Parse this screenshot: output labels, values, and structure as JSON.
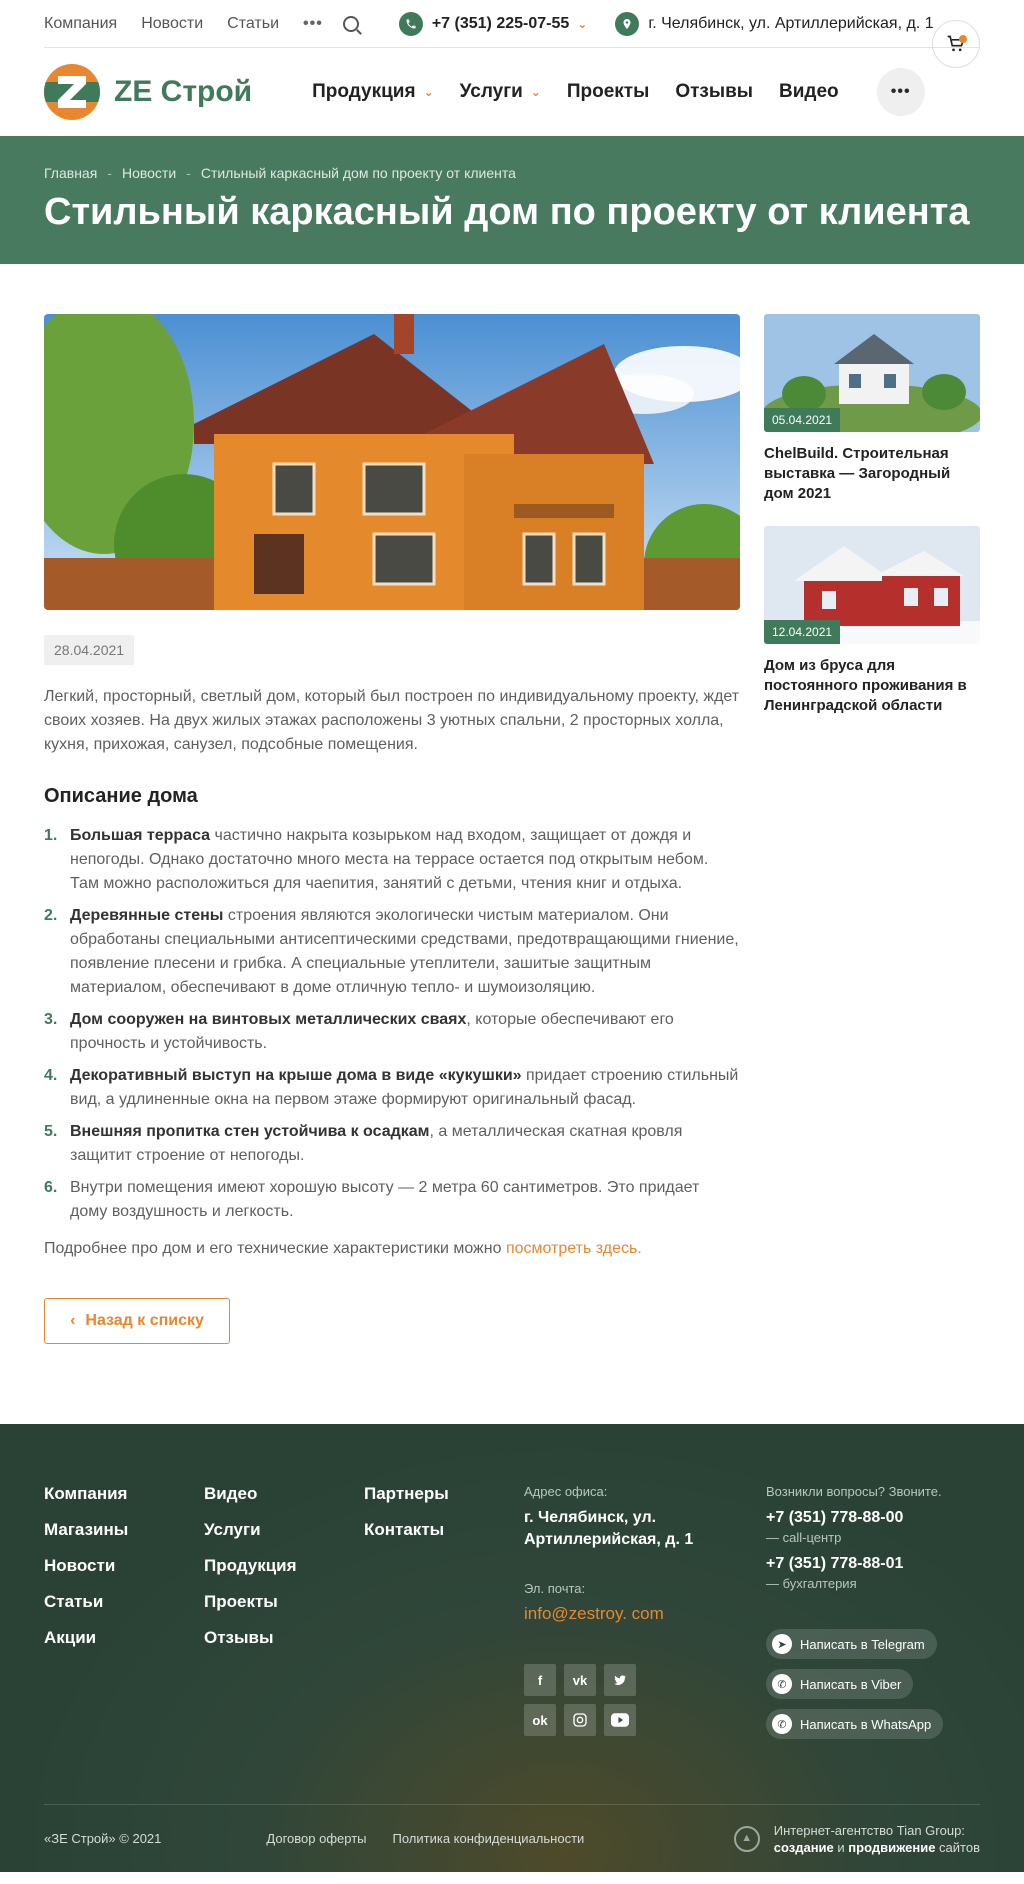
{
  "topbar": {
    "links": [
      "Компания",
      "Новости",
      "Статьи"
    ],
    "more": "•••",
    "phone": "+7 (351) 225-07-55",
    "address": "г. Челябинск, ул. Артиллерийская, д. 1"
  },
  "header": {
    "brand": "ZE Строй",
    "nav": [
      "Продукция",
      "Услуги",
      "Проекты",
      "Отзывы",
      "Видео"
    ],
    "more": "•••"
  },
  "breadcrumbs": [
    "Главная",
    "Новости",
    "Стильный каркасный дом по проекту от клиента"
  ],
  "title": "Стильный каркасный дом по проекту от клиента",
  "article": {
    "date": "28.04.2021",
    "intro": "Легкий, просторный, светлый дом, который был построен по индивидуальному проекту, ждет своих хозяев. На двух жилых этажах расположены 3 уютных спальни, 2 просторных холла, кухня, прихожая, санузел, подсобные помещения.",
    "heading": "Описание дома",
    "items": [
      {
        "num": "1.",
        "bold": "Большая терраса",
        "text": " частично накрыта козырьком над входом, защищает от дождя и непогоды. Однако достаточно много места на террасе остается под открытым небом. Там можно расположиться для чаепития, занятий с детьми, чтения книг и отдыха."
      },
      {
        "num": "2.",
        "bold": "Деревянные стены",
        "text": " строения являются экологически чистым материалом. Они обработаны специальными антисептическими средствами, предотвращающими гниение, появление плесени и грибка. А специальные утеплители, зашитые защитным материалом, обеспечивают в доме отличную тепло- и шумоизоляцию."
      },
      {
        "num": "3.",
        "bold": "Дом сооружен на винтовых металлических сваях",
        "text": ", которые обеспечивают его прочность и устойчивость."
      },
      {
        "num": "4.",
        "bold": "Декоративный выступ на крыше дома в виде «кукушки»",
        "text": " придает строению стильный вид, а удлиненные окна на первом этаже формируют оригинальный фасад."
      },
      {
        "num": "5.",
        "bold": "Внешняя пропитка стен устойчива к осадкам",
        "text": ", а металлическая скатная кровля защитит строение от непогоды."
      },
      {
        "num": "6.",
        "bold": "",
        "text": "Внутри помещения имеют хорошую высоту — 2 метра 60 сантиметров. Это придает дому воздушность и легкость."
      }
    ],
    "more_text": "Подробнее про дом и его технические характеристики можно ",
    "more_link": "посмотреть здесь.",
    "back": "Назад к списку"
  },
  "sidebar": [
    {
      "date": "05.04.2021",
      "title": "ChelBuild. Строительная выставка — Загородный дом 2021"
    },
    {
      "date": "12.04.2021",
      "title": "Дом из бруса для постоянного проживания в Ленинградской области"
    }
  ],
  "footer": {
    "col1": [
      "Компания",
      "Магазины",
      "Новости",
      "Статьи",
      "Акции"
    ],
    "col2": [
      "Видео",
      "Услуги",
      "Продукция",
      "Проекты",
      "Отзывы"
    ],
    "col3": [
      "Партнеры",
      "Контакты"
    ],
    "office_label": "Адрес офиса:",
    "office": "г. Челябинск, ул. Артиллерийская, д. 1",
    "email_label": "Эл. почта:",
    "email": "info@zestroy. com",
    "social": [
      "f",
      "vk",
      "tw",
      "ok",
      "ig",
      "yt"
    ],
    "questions": "Возникли вопросы? Звоните.",
    "phone1": "+7 (351) 778-88-00",
    "phone1_sub": "— call-центр",
    "phone2": "+7 (351) 778-88-01",
    "phone2_sub": "— бухгалтерия",
    "messengers": [
      "Написать в Telegram",
      "Написать в Viber",
      "Написать в WhatsApp"
    ],
    "copyright": "«ЗЕ Строй» © 2021",
    "offer": "Договор оферты",
    "privacy": "Политика конфиденциальности",
    "agency_line1": "Интернет-агентство Tian Group:",
    "agency_w1": "создание",
    "agency_and": " и ",
    "agency_w2": "продвижение",
    "agency_end": " сайтов"
  },
  "colors": {
    "accent": "#e8872f",
    "brand_green": "#3f7a5b",
    "banner": "#477a5e",
    "footer": "#2a4236"
  }
}
